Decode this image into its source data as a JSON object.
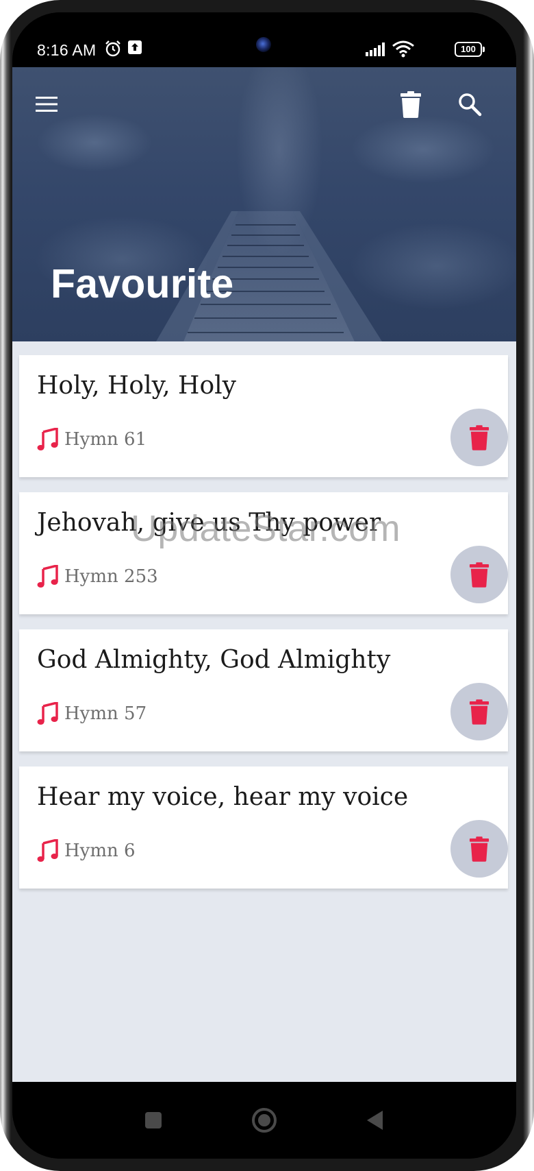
{
  "status_bar": {
    "time": "8:16 AM",
    "battery": "100"
  },
  "header": {
    "title": "Favourite",
    "menu_icon": "hamburger-menu-icon",
    "delete_all_icon": "trash-icon",
    "search_icon": "search-icon"
  },
  "favourites": [
    {
      "title": "Holy, Holy, Holy",
      "hymn": "Hymn 61"
    },
    {
      "title": "Jehovah, give us Thy power",
      "hymn": "Hymn 253"
    },
    {
      "title": "God Almighty, God Almighty",
      "hymn": "Hymn 57"
    },
    {
      "title": "Hear my voice, hear my voice",
      "hymn": "Hymn 6"
    }
  ],
  "watermark": "UpdateStar.com",
  "colors": {
    "accent": "#e8234a",
    "delete_bg": "#c6cbd8",
    "list_bg": "#e4e8ef"
  }
}
